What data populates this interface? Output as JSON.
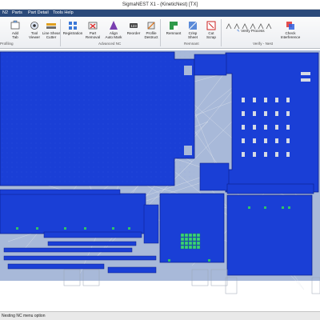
{
  "window": {
    "title": "SigmaNEST X1 -       (KineticNest) [TX]"
  },
  "menu": {
    "items": [
      "N2",
      "Parts",
      "Part Detail",
      "Tools Help"
    ]
  },
  "ribbon": {
    "buttons": [
      {
        "label": "Add\nTab",
        "icon": "add-tab-icon"
      },
      {
        "label": "Tool\nViewer",
        "icon": "tool-viewer-icon"
      },
      {
        "label": "Line Shear\nCutter",
        "icon": "line-shear-cutter-icon"
      },
      {
        "label": "Registration",
        "icon": "registration-icon"
      },
      {
        "label": "Part\nRemoval",
        "icon": "part-removal-icon"
      },
      {
        "label": "Align\nAuto Mark",
        "icon": "align-auto-mark-icon"
      },
      {
        "label": "Reorder",
        "icon": "reorder-icon"
      },
      {
        "label": "Profile\nDestruct",
        "icon": "profile-destruct-icon"
      },
      {
        "label": "Remnant",
        "icon": "remnant-icon"
      },
      {
        "label": "Crisp\nSheet",
        "icon": "crisp-sheet-icon"
      },
      {
        "label": "Cut\nScrap",
        "icon": "cut-scrap-icon"
      },
      {
        "label": "Check\nInterference",
        "icon": "check-interference-icon"
      }
    ],
    "verify_label": "Verify Process",
    "groups": [
      "Profiling",
      "Advanced NC",
      "Remnant",
      "Verify - Nest"
    ]
  },
  "status": {
    "text": "Nesting NC menu option"
  },
  "colors": {
    "plate": "#1a3fd6",
    "plate_edge": "#0a1f8a",
    "sheet_bg": "#a8b9d9",
    "part_green": "#3ad17a",
    "path_line": "#e3e6ec",
    "menubar": "#2b4a7a"
  }
}
